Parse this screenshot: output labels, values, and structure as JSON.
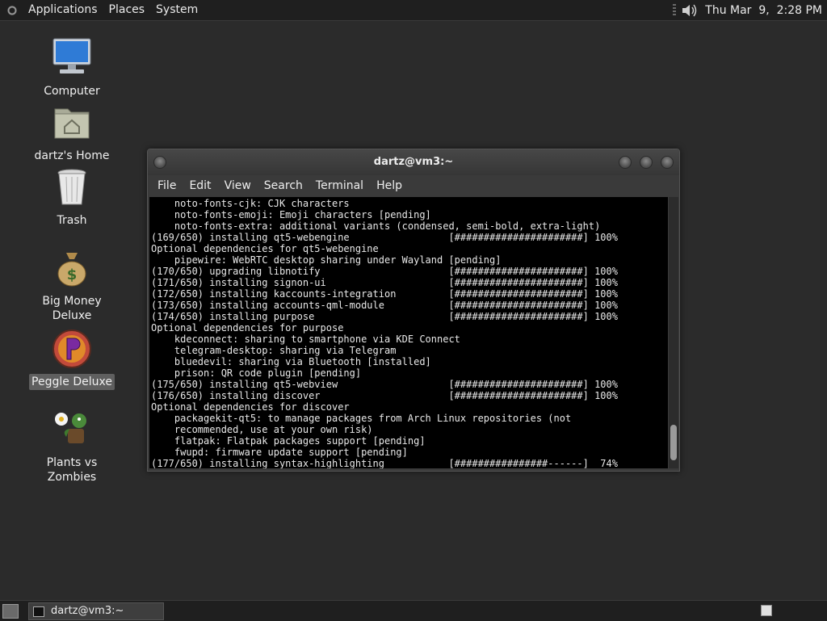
{
  "top_panel": {
    "menus": [
      "Applications",
      "Places",
      "System"
    ],
    "clock": "Thu Mar  9,  2:28 PM"
  },
  "desktop_icons": [
    {
      "label": "Computer",
      "icon": "computer-icon"
    },
    {
      "label": "dartz's Home",
      "icon": "home-folder-icon"
    },
    {
      "label": "Trash",
      "icon": "trash-icon"
    },
    {
      "label": "Big Money Deluxe",
      "icon": "money-bag-icon"
    },
    {
      "label": "Peggle Deluxe",
      "icon": "peggle-icon"
    },
    {
      "label": "Plants vs Zombies",
      "icon": "plants-vs-zombies-icon"
    }
  ],
  "terminal": {
    "title": "dartz@vm3:~",
    "menu": [
      "File",
      "Edit",
      "View",
      "Search",
      "Terminal",
      "Help"
    ],
    "lines": [
      "    noto-fonts-cjk: CJK characters",
      "    noto-fonts-emoji: Emoji characters [pending]",
      "    noto-fonts-extra: additional variants (condensed, semi-bold, extra-light)",
      "(169/650) installing qt5-webengine                 [######################] 100%",
      "Optional dependencies for qt5-webengine",
      "    pipewire: WebRTC desktop sharing under Wayland [pending]",
      "(170/650) upgrading libnotify                      [######################] 100%",
      "(171/650) installing signon-ui                     [######################] 100%",
      "(172/650) installing kaccounts-integration         [######################] 100%",
      "(173/650) installing accounts-qml-module           [######################] 100%",
      "(174/650) installing purpose                       [######################] 100%",
      "Optional dependencies for purpose",
      "    kdeconnect: sharing to smartphone via KDE Connect",
      "    telegram-desktop: sharing via Telegram",
      "    bluedevil: sharing via Bluetooth [installed]",
      "    prison: QR code plugin [pending]",
      "(175/650) installing qt5-webview                   [######################] 100%",
      "(176/650) installing discover                      [######################] 100%",
      "Optional dependencies for discover",
      "    packagekit-qt5: to manage packages from Arch Linux repositories (not",
      "    recommended, use at your own risk)",
      "    flatpak: Flatpak packages support [pending]",
      "    fwupd: firmware update support [pending]",
      "(177/650) installing syntax-highlighting           [################------]  74%"
    ]
  },
  "taskbar": {
    "task_label": "dartz@vm3:~"
  }
}
